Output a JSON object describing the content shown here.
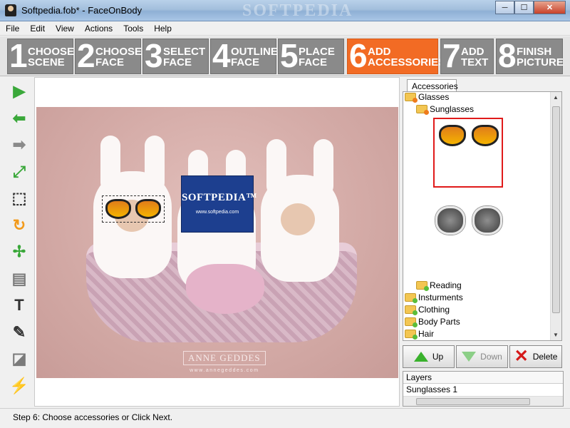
{
  "window": {
    "title": "Softpedia.fob* - FaceOnBody",
    "watermark": "SOFTPEDIA",
    "controls": {
      "minimize": "─",
      "maximize": "☐",
      "close": "✕"
    }
  },
  "menu": [
    "File",
    "Edit",
    "View",
    "Actions",
    "Tools",
    "Help"
  ],
  "steps": [
    {
      "num": "1",
      "label": "CHOOSE\nSCENE",
      "active": false
    },
    {
      "num": "2",
      "label": "CHOOSE\nFACE",
      "active": false
    },
    {
      "num": "3",
      "label": "SELECT\nFACE",
      "active": false
    },
    {
      "num": "4",
      "label": "OUTLINE\nFACE",
      "active": false
    },
    {
      "num": "5",
      "label": "PLACE\nFACE",
      "active": false
    },
    {
      "num": "6",
      "label": "ADD\nACCESSORIES",
      "active": true
    },
    {
      "num": "7",
      "label": "ADD\nTEXT",
      "active": false
    },
    {
      "num": "8",
      "label": "FINISH\nPICTURE",
      "active": false
    }
  ],
  "tools": [
    {
      "name": "play-icon",
      "glyph": "▶",
      "color": "#3aa83a"
    },
    {
      "name": "back-arrow-icon",
      "glyph": "⬅",
      "color": "#3aa83a"
    },
    {
      "name": "forward-arrow-icon",
      "glyph": "➡",
      "color": "#8a8a8a"
    },
    {
      "name": "fit-expand-icon",
      "glyph": "⤢",
      "color": "#3aa83a"
    },
    {
      "name": "select-region-icon",
      "glyph": "⬚",
      "color": "#333333"
    },
    {
      "name": "rotate-icon",
      "glyph": "↻",
      "color": "#f29a1b"
    },
    {
      "name": "collapse-icon",
      "glyph": "✢",
      "color": "#3aa83a"
    },
    {
      "name": "gradient-icon",
      "glyph": "▤",
      "color": "#7a7a7a"
    },
    {
      "name": "text-tool-icon",
      "glyph": "T",
      "color": "#333333"
    },
    {
      "name": "brush-icon",
      "glyph": "✎",
      "color": "#333333"
    },
    {
      "name": "eraser-icon",
      "glyph": "◪",
      "color": "#7a7a7a"
    },
    {
      "name": "effects-icon",
      "glyph": "⚡",
      "color": "#7a7a7a"
    }
  ],
  "canvas": {
    "logo_title": "SOFTPEDIA™",
    "logo_url": "www.softpedia.com",
    "credit_name": "ANNE GEDDES",
    "credit_site": "www.annegeddes.com"
  },
  "panel": {
    "tab": "Accessories",
    "tree": {
      "glasses": "Glasses",
      "sunglasses": "Sunglasses",
      "reading": "Reading",
      "instruments": "Insturments",
      "clothing": "Clothing",
      "body_parts": "Body Parts",
      "hair": "Hair"
    },
    "buttons": {
      "up": "Up",
      "down": "Down",
      "delete": "Delete"
    },
    "layers_header": "Layers",
    "layers": [
      "Sunglasses 1"
    ]
  },
  "status": "Step 6: Choose accessories or Click Next."
}
